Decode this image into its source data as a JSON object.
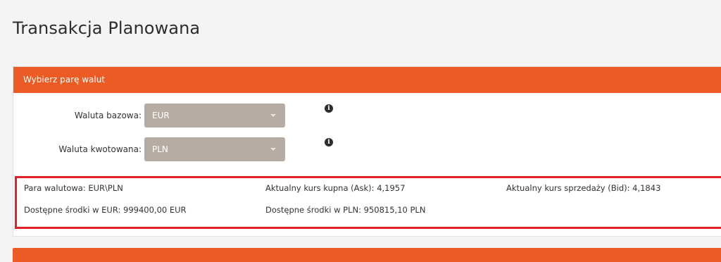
{
  "page": {
    "title": "Transakcja Planowana"
  },
  "panel": {
    "header": "Wybierz parę walut",
    "base_currency": {
      "label": "Waluta bazowa:",
      "value": "EUR"
    },
    "quote_currency": {
      "label": "Waluta kwotowana:",
      "value": "PLN"
    },
    "info_icon_glyph": "i"
  },
  "info": {
    "pair": "Para walutowa: EUR\\PLN",
    "ask": "Aktualny kurs kupna (Ask): 4,1957",
    "bid": "Aktualny kurs sprzedaży (Bid): 4,1843",
    "funds_base": "Dostępne środki w EUR: 999400,00 EUR",
    "funds_quote": "Dostępne środki w PLN: 950815,10 PLN"
  },
  "colors": {
    "accent": "#ec5b24",
    "select_bg": "#b7aca3",
    "highlight_border": "#e3202a"
  }
}
